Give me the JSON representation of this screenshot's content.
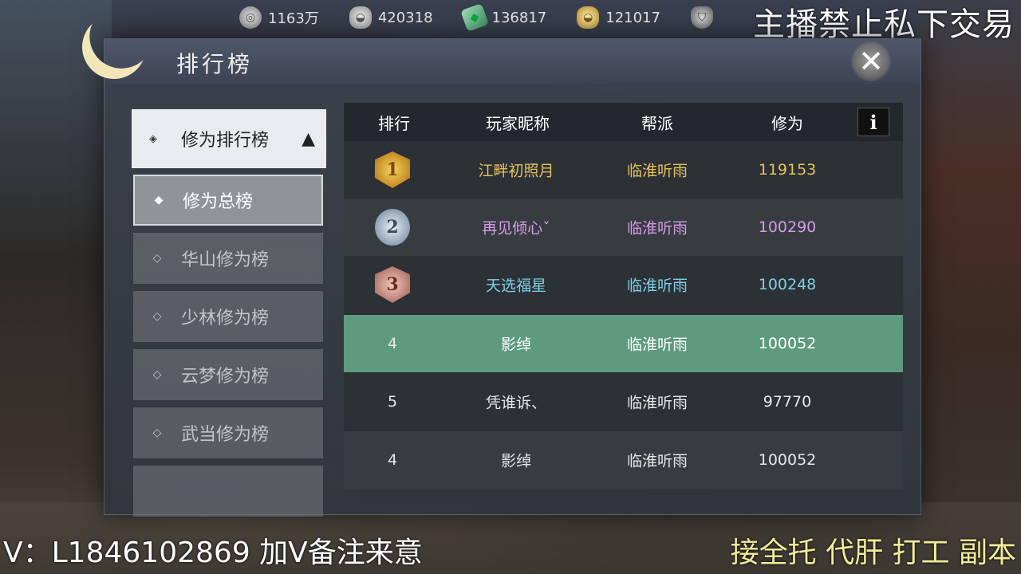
{
  "currencies": [
    {
      "icon": "coin-icon",
      "value": "1163万"
    },
    {
      "icon": "silver-ingot-icon",
      "value": "420318"
    },
    {
      "icon": "jade-icon",
      "value": "136817"
    },
    {
      "icon": "gold-ingot-icon",
      "value": "121017"
    },
    {
      "icon": "shield-icon",
      "value": ""
    }
  ],
  "overlay": {
    "notice": "主播禁止私下交易",
    "contact": "V：L1846102869 加V备注来意",
    "service": "接全托 代肝 打工 副本"
  },
  "window": {
    "title": "排行榜",
    "close_label": "✕"
  },
  "sidebar": {
    "category": {
      "label": "修为排行榜",
      "chevron": "▲"
    },
    "items": [
      {
        "label": "修为总榜",
        "active": true
      },
      {
        "label": "华山修为榜",
        "active": false
      },
      {
        "label": "少林修为榜",
        "active": false
      },
      {
        "label": "云梦修为榜",
        "active": false
      },
      {
        "label": "武当修为榜",
        "active": false
      }
    ]
  },
  "table": {
    "headers": {
      "rank": "排行",
      "name": "玩家昵称",
      "guild": "帮派",
      "score": "修为"
    },
    "info_label": "i",
    "rows": [
      {
        "rank": "1",
        "name": "江畔初照月",
        "guild": "临淮听雨",
        "score": "119153",
        "color": "#e6c15a",
        "badge": "gold"
      },
      {
        "rank": "2",
        "name": "再见倾心ˇ",
        "guild": "临淮听雨",
        "score": "100290",
        "color": "#d79be8",
        "badge": "silver"
      },
      {
        "rank": "3",
        "name": "天选福星",
        "guild": "临淮听雨",
        "score": "100248",
        "color": "#7fd0e6",
        "badge": "bronze"
      },
      {
        "rank": "4",
        "name": "影绰",
        "guild": "临淮听雨",
        "score": "100052",
        "color": "#ffffff",
        "badge": ""
      },
      {
        "rank": "5",
        "name": "凭谁诉、",
        "guild": "临淮听雨",
        "score": "97770",
        "color": "#e8e8e8",
        "badge": ""
      },
      {
        "rank": "4",
        "name": "影绰",
        "guild": "临淮听雨",
        "score": "100052",
        "color": "#e8e8e8",
        "badge": ""
      }
    ]
  }
}
